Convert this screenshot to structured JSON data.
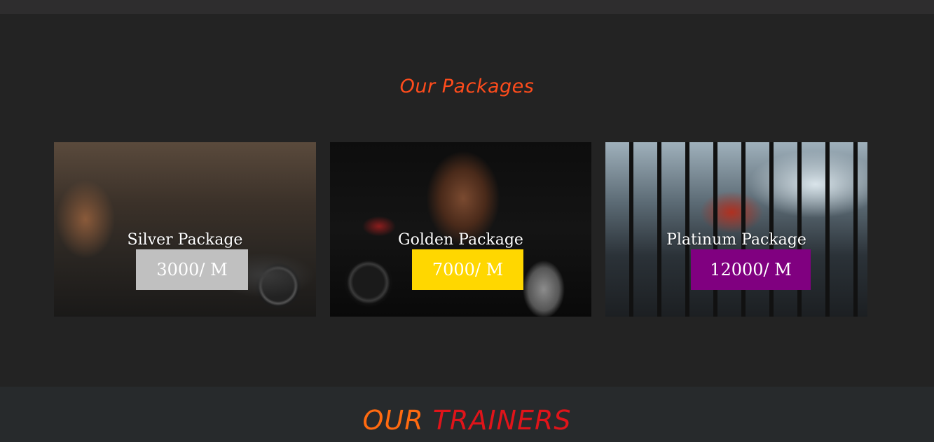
{
  "packages": {
    "title": "Our Packages",
    "title_color": "#ff4c1c",
    "items": [
      {
        "name": "Silver Package",
        "price": "3000/ M",
        "price_color": "#c0c0c0"
      },
      {
        "name": "Golden Package",
        "price": "7000/ M",
        "price_color": "#ffd700"
      },
      {
        "name": "Platinum Package",
        "price": "12000/ M",
        "price_color": "#800080"
      }
    ]
  },
  "trainers": {
    "title_part1": "OUR",
    "title_part2": "TRAINERS",
    "title_part1_color": "#ff6a10",
    "title_part2_color": "#e0141a"
  }
}
